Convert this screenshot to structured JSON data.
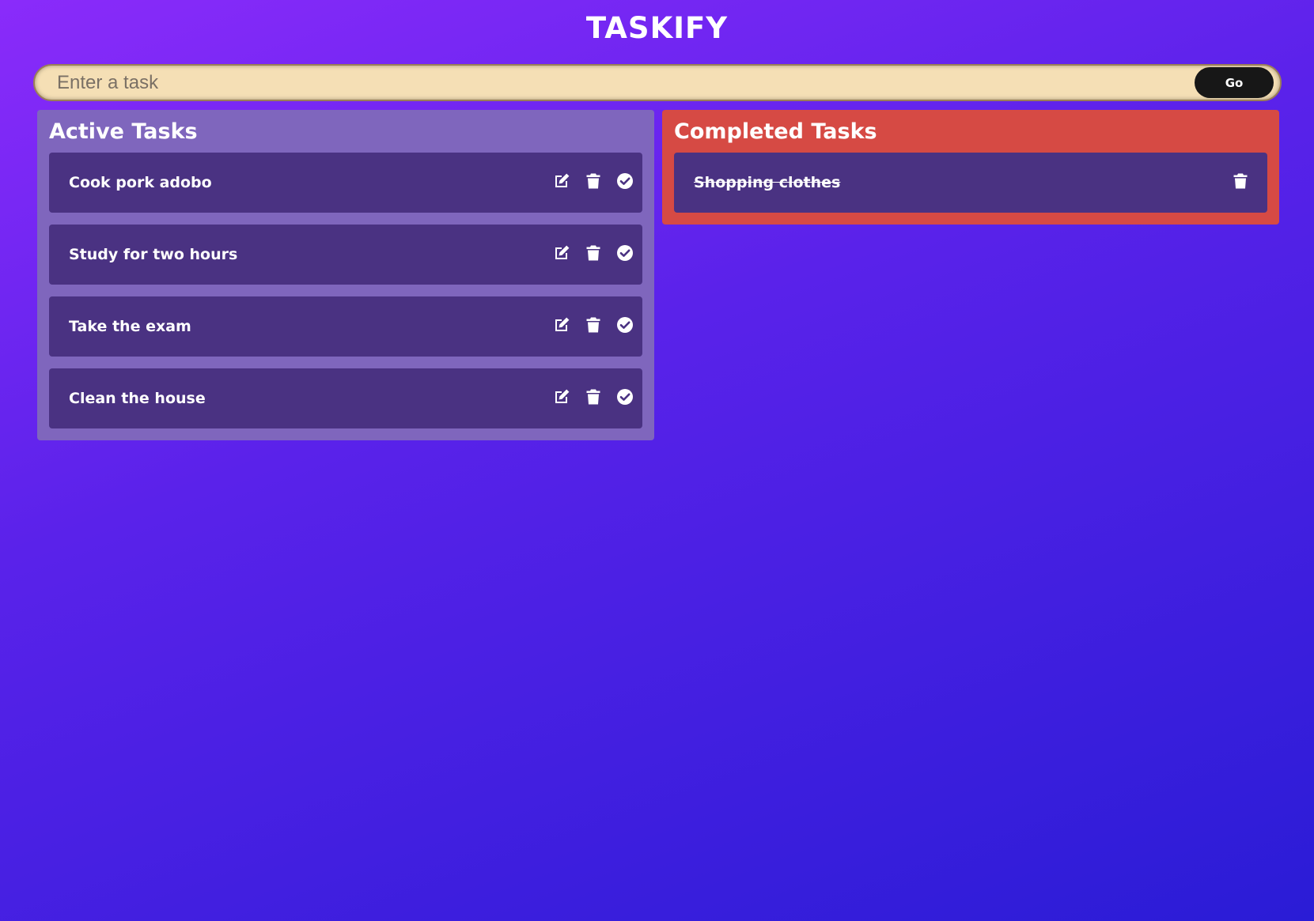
{
  "app": {
    "title": "TASKIFY"
  },
  "form": {
    "placeholder": "Enter a task",
    "value": "",
    "submit_label": "Go"
  },
  "active": {
    "heading": "Active Tasks",
    "tasks": [
      {
        "text": "Cook pork adobo"
      },
      {
        "text": "Study for two hours"
      },
      {
        "text": "Take the exam"
      },
      {
        "text": "Clean the house"
      }
    ]
  },
  "completed": {
    "heading": "Completed Tasks",
    "tasks": [
      {
        "text": "Shopping clothes"
      }
    ]
  },
  "icons": {
    "edit": "edit-icon",
    "delete": "trash-icon",
    "done": "check-circle-icon"
  },
  "colors": {
    "background_start": "#8a2bfa",
    "background_end": "#2a1cd6",
    "input_background": "#f5dfb5",
    "go_button": "#171717",
    "active_panel": "#7f66bd",
    "completed_panel": "#d64a44",
    "task_card": "#4a3282",
    "text": "#ffffff"
  }
}
